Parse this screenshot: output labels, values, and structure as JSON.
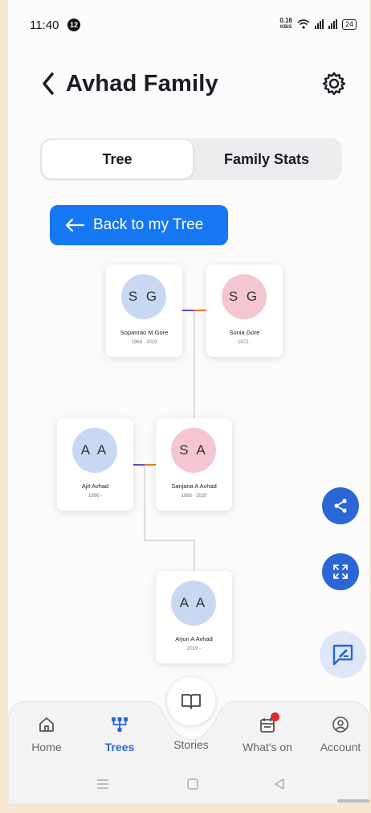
{
  "status_bar": {
    "time": "11:40",
    "notification_count": "12",
    "net_speed_value": "0.16",
    "net_speed_unit": "KB/S",
    "battery": "24"
  },
  "header": {
    "title": "Avhad Family",
    "back_icon": "chevron-left-icon",
    "settings_icon": "gear-icon"
  },
  "tabs": [
    {
      "label": "Tree",
      "active": true
    },
    {
      "label": "Family Stats",
      "active": false
    }
  ],
  "back_to_tree": {
    "label": "Back to my Tree",
    "icon": "arrow-left-icon"
  },
  "family_tree": {
    "members": [
      {
        "initials": "S G",
        "name": "Sopanrao M Gore",
        "years": "1968 - 2019",
        "color": "#c8d7f2"
      },
      {
        "initials": "S G",
        "name": "Sonia Gore",
        "years": "1972 -",
        "color": "#f4c6d2"
      },
      {
        "initials": "A A",
        "name": "Ajit Avhad",
        "years": "1996 -",
        "color": "#c8d7f2"
      },
      {
        "initials": "S A",
        "name": "Sanjana A Avhad",
        "years": "1998 - 2020",
        "color": "#f4c6d2"
      },
      {
        "initials": "A A",
        "name": "Arjun A Avhad",
        "years": "2019 -",
        "color": "#c8d7f2"
      }
    ],
    "couple_line_colors": {
      "left": "#6b4ad6",
      "right": "#f07a28"
    }
  },
  "fabs": {
    "share_icon": "share-icon",
    "expand_icon": "expand-icon",
    "chat_icon": "chat-edit-icon"
  },
  "bottom_nav": {
    "center_icon": "book-icon",
    "items": [
      {
        "label": "Home",
        "icon": "home-icon",
        "active": false
      },
      {
        "label": "Trees",
        "icon": "tree-icon",
        "active": true
      },
      {
        "label": "Stories",
        "icon": "",
        "active": false
      },
      {
        "label": "What's on",
        "icon": "calendar-icon",
        "active": false,
        "badge": true
      },
      {
        "label": "Account",
        "icon": "account-icon",
        "active": false
      }
    ]
  },
  "colors": {
    "primary": "#1677f2",
    "nav_active": "#2a66d6",
    "badge": "#e3242b"
  }
}
